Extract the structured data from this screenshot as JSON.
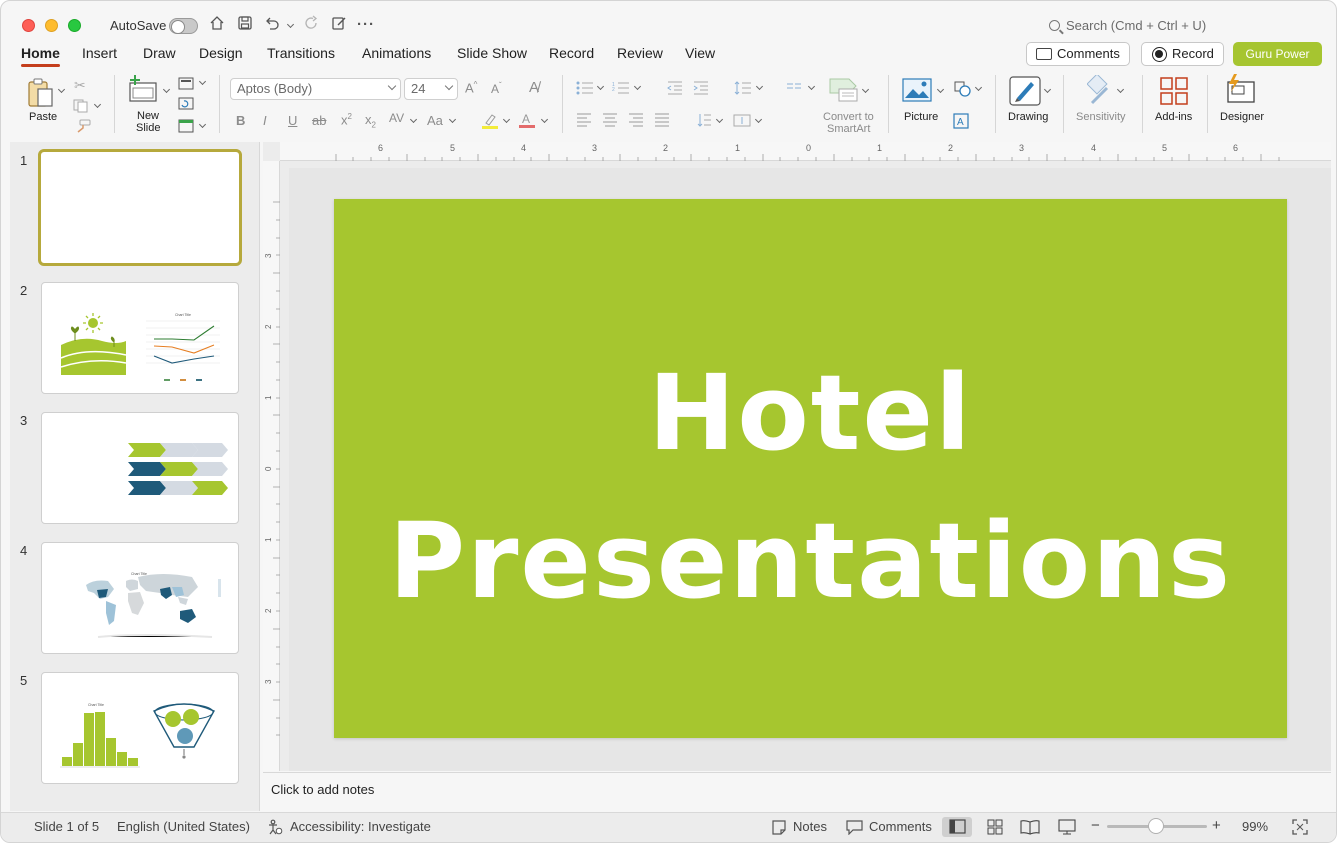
{
  "titlebar": {
    "autosave_label": "AutoSave",
    "search_placeholder": "Search (Cmd + Ctrl + U)"
  },
  "tabs": [
    {
      "label": "Home",
      "active": true
    },
    {
      "label": "Insert"
    },
    {
      "label": "Draw"
    },
    {
      "label": "Design"
    },
    {
      "label": "Transitions"
    },
    {
      "label": "Animations"
    },
    {
      "label": "Slide Show"
    },
    {
      "label": "Record"
    },
    {
      "label": "Review"
    },
    {
      "label": "View"
    }
  ],
  "header_buttons": {
    "comments": "Comments",
    "record": "Record",
    "guru": "Guru Power"
  },
  "ribbon": {
    "paste": "Paste",
    "new_slide_1": "New",
    "new_slide_2": "Slide",
    "font_name": "Aptos (Body)",
    "font_size": "24",
    "convert_1": "Convert to",
    "convert_2": "SmartArt",
    "picture": "Picture",
    "drawing": "Drawing",
    "sensitivity": "Sensitivity",
    "addins": "Add-ins",
    "designer": "Designer"
  },
  "slides": [
    {
      "number": "1"
    },
    {
      "number": "2"
    },
    {
      "number": "3"
    },
    {
      "number": "4"
    },
    {
      "number": "5"
    }
  ],
  "slide": {
    "title": "Hotel\nPresentations",
    "background": "#a6c62f"
  },
  "notes_placeholder": "Click to add notes",
  "statusbar": {
    "slide_info": "Slide 1 of 5",
    "language": "English (United States)",
    "accessibility": "Accessibility: Investigate",
    "notes": "Notes",
    "comments": "Comments",
    "zoom": "99%"
  },
  "colors": {
    "accent": "#c43e1c",
    "brand_green": "#a6c530",
    "dark_teal": "#1f5a7a"
  }
}
